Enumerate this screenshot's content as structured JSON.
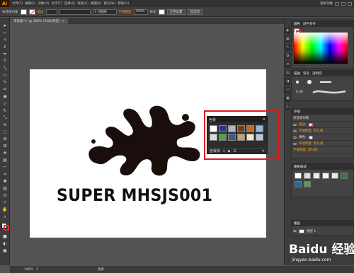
{
  "app": {
    "logo": "Ai",
    "menu": [
      "文件(F)",
      "编辑(E)",
      "对象(O)",
      "文字(T)",
      "选择(S)",
      "效果(C)",
      "视图(V)",
      "窗口(W)",
      "帮助(H)"
    ],
    "workspace": "基本功能"
  },
  "controlbar": {
    "selection": "未选择对象",
    "stroke_label": "描边",
    "brush": "5 点圆形",
    "opacity_label": "不透明度",
    "opacity": "100%",
    "style_label": "样式",
    "doc_setup": "文档设置",
    "prefs": "首选项"
  },
  "document": {
    "tab": "未标题-1* @ 100% (RGB/预览)"
  },
  "artboard": {
    "text": "SUPER MHSJS001",
    "ink_color": "#1a0e0c"
  },
  "swatch_panel": {
    "title": "色板",
    "swatches": [
      "#ffffff",
      "#2a3a8a",
      "#a7b9c7",
      "#7a3c18",
      "#c46a1e",
      "#8fb7d9",
      "#d9d9d9",
      "#4ca34c",
      "#3a5d7a",
      "#c8a06a",
      "#efe4d0",
      "#b8c8d8"
    ],
    "footer": [
      "色板库",
      "▾",
      "◆",
      "☰"
    ]
  },
  "dock": {
    "color_tabs": [
      "颜色",
      "颜色参考"
    ],
    "brush_tabs": [
      "描边",
      "渐变",
      "透明度"
    ],
    "brush_size": "6.00",
    "appearance_title": "外观",
    "appearance_rows": [
      "未选择对象",
      "描边:",
      "不透明度: 默认值",
      "填色:",
      "不透明度: 默认值",
      "不透明度: 默认值"
    ],
    "default_value": "默认值",
    "graphic_styles_title": "图形样式",
    "layers_title": "图层",
    "layer_name": "图层 1"
  },
  "statusbar": {
    "zoom": "100%",
    "page": "1",
    "mode": "选择"
  },
  "watermark": {
    "brand": "Baidu 经验",
    "url": "jingyan.baidu.com"
  }
}
